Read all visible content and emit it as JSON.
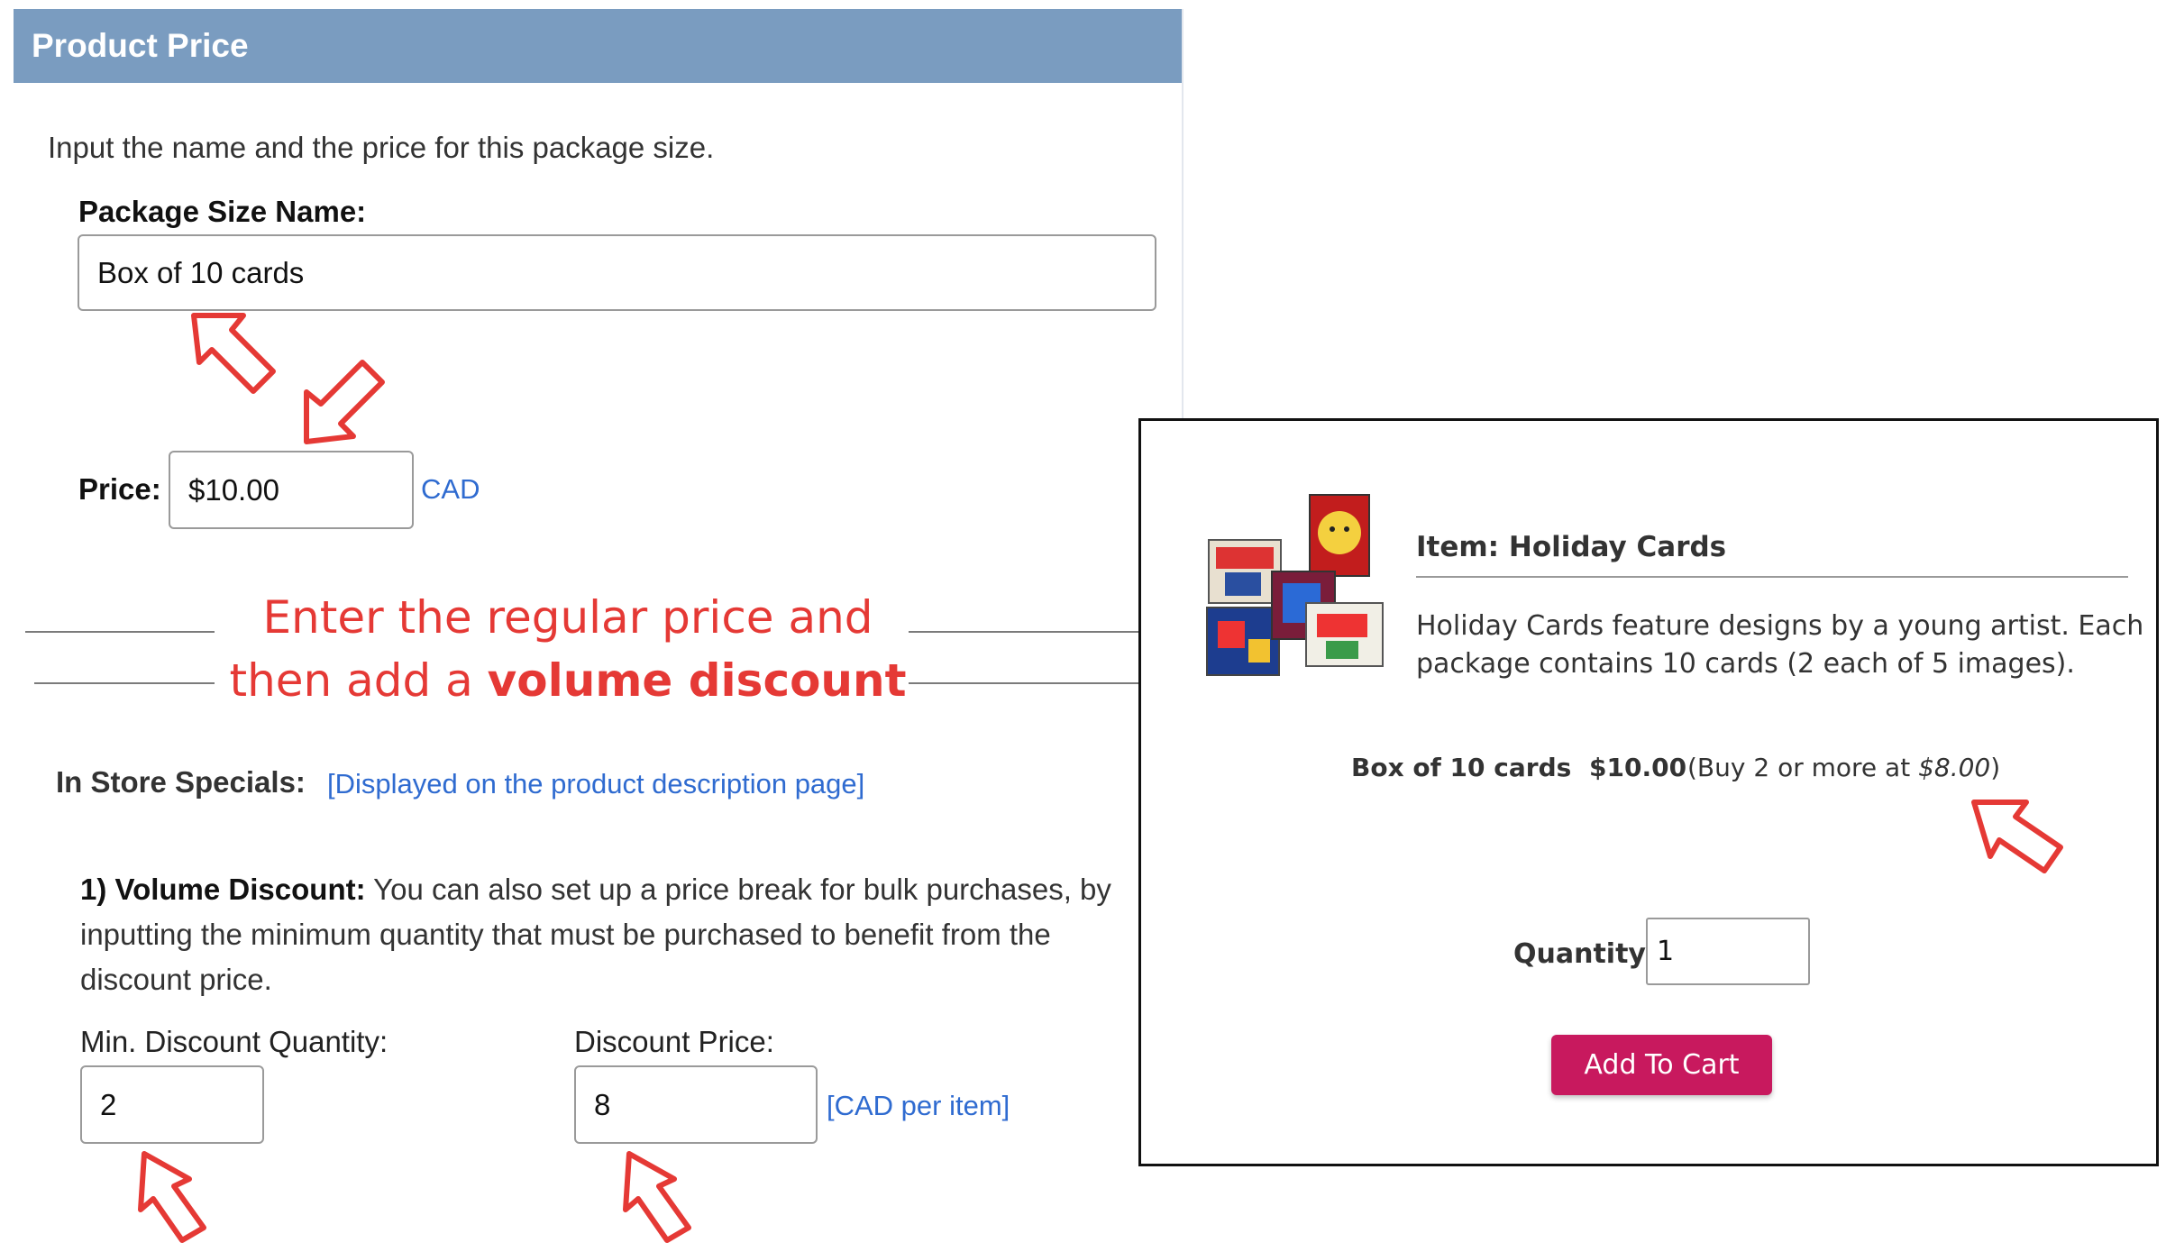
{
  "panel": {
    "title": "Product Price",
    "intro": "Input the name and the price for this package size.",
    "package_label": "Package Size Name:",
    "package_value": "Box of 10 cards",
    "price_label": "Price:",
    "price_value": "$10.00",
    "currency": "CAD",
    "specials_label": "In Store Specials:",
    "specials_note": "[Displayed on the product description page]",
    "volume_heading": "1) Volume Discount:",
    "volume_text_1": " You can also set up a price break for bulk purchases, by",
    "volume_text_2": "inputting the minimum quantity that must be purchased to benefit from the",
    "volume_text_3": "discount price.",
    "min_qty_label": "Min. Discount Quantity:",
    "min_qty_value": "2",
    "discount_label": "Discount Price:",
    "discount_value": "8",
    "discount_unit": "[CAD per item]"
  },
  "banner": {
    "line1": "Enter the regular price and",
    "line2_prefix": "then add a ",
    "line2_bold": "volume discount"
  },
  "preview": {
    "item_title": "Item: Holiday Cards",
    "desc_1": "Holiday Cards feature designs by a young artist. Each",
    "desc_2": "package contains 10 cards (2 each of 5 images).",
    "package_name": "Box of 10 cards",
    "price": "$10.00",
    "discount_prefix": "(Buy 2 or more at ",
    "discount_price": "$8.00",
    "discount_suffix": ")",
    "quantity_label": "Quantity:",
    "quantity_value": "1",
    "add_button": "Add To Cart"
  },
  "colors": {
    "header_bg": "#7a9cc0",
    "annotation_red": "#e53935",
    "link_blue": "#2f6bd0",
    "button_magenta": "#c8195e"
  },
  "icons": [
    "arrow-annotation-icon",
    "holiday-cards-thumbnail"
  ]
}
